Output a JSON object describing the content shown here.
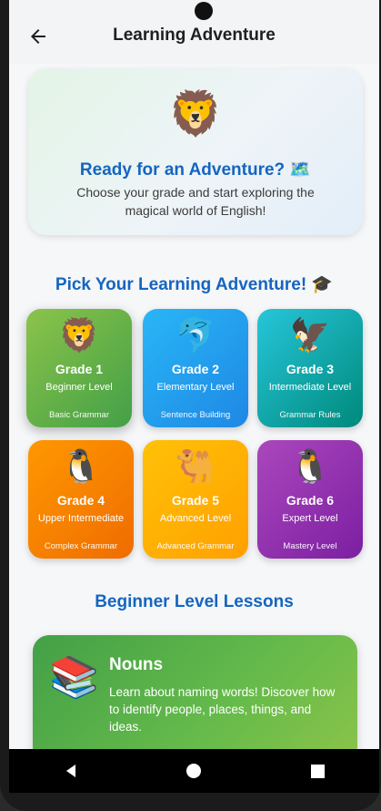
{
  "appbar": {
    "title": "Learning Adventure",
    "back_icon": "arrow-left-icon"
  },
  "hero": {
    "emoji": "🦁",
    "title": "Ready for an Adventure? 🗺️",
    "subtitle": "Choose your grade and start exploring the magical world of English!"
  },
  "pick_title": "Pick Your Learning Adventure! 🎓",
  "grades": [
    {
      "emoji": "🦁",
      "name": "Grade 1",
      "level": "Beginner Level",
      "tag": "Basic Grammar",
      "color_from": "#43a047",
      "color_to": "#8bc34a",
      "selected": true
    },
    {
      "emoji": "🐬",
      "name": "Grade 2",
      "level": "Elementary Level",
      "tag": "Sentence Building",
      "color_from": "#1e88e5",
      "color_to": "#29b6f6"
    },
    {
      "emoji": "🦅",
      "name": "Grade 3",
      "level": "Intermediate Level",
      "tag": "Grammar Rules",
      "color_from": "#00897b",
      "color_to": "#26c6da"
    },
    {
      "emoji": "🐧",
      "name": "Grade 4",
      "level": "Upper Intermediate",
      "tag": "Complex Grammar",
      "color_from": "#ef6c00",
      "color_to": "#ff9800"
    },
    {
      "emoji": "🐫",
      "name": "Grade 5",
      "level": "Advanced Level",
      "tag": "Advanced Grammar",
      "color_from": "#ffa000",
      "color_to": "#ffc107"
    },
    {
      "emoji": "🐧",
      "name": "Grade 6",
      "level": "Expert Level",
      "tag": "Mastery Level",
      "color_from": "#7b1fa2",
      "color_to": "#ab47bc"
    }
  ],
  "lessons_title": "Beginner Level Lessons",
  "lesson": {
    "emoji": "📚",
    "title": "Nouns",
    "description": "Learn about naming words! Discover how to identify people, places, things, and ideas."
  },
  "nav": {
    "back": "back-triangle-icon",
    "home": "home-circle-icon",
    "recents": "recents-square-icon"
  }
}
